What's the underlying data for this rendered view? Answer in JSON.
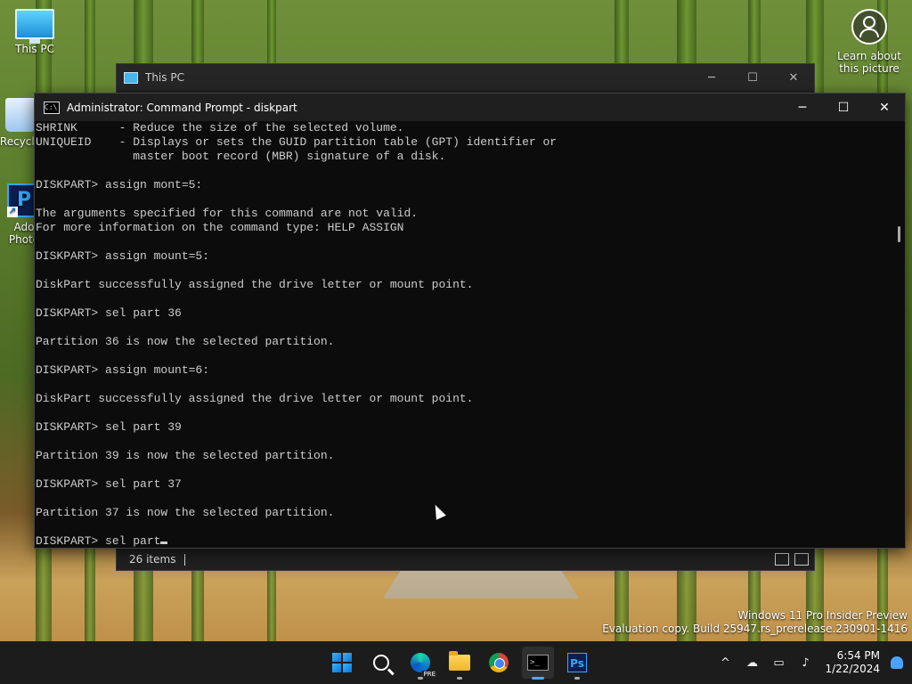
{
  "desktop": {
    "icons": [
      {
        "label": "This PC"
      },
      {
        "label": "Recycle"
      },
      {
        "label": "Ado\nPhoto"
      }
    ],
    "learn_label": "Learn about this picture",
    "watermark": {
      "line1": "Windows 11 Pro Insider Preview",
      "line2": "Evaluation copy. Build 25947.rs_prerelease.230901-1416"
    }
  },
  "explorer": {
    "title": "This PC",
    "status_count": "26 items"
  },
  "cmd": {
    "title": "Administrator: Command Prompt - diskpart",
    "lines": [
      "SHRINK      - Reduce the size of the selected volume.",
      "UNIQUEID    - Displays or sets the GUID partition table (GPT) identifier or",
      "              master boot record (MBR) signature of a disk.",
      "",
      "DISKPART> assign mont=5:",
      "",
      "The arguments specified for this command are not valid.",
      "For more information on the command type: HELP ASSIGN",
      "",
      "DISKPART> assign mount=5:",
      "",
      "DiskPart successfully assigned the drive letter or mount point.",
      "",
      "DISKPART> sel part 36",
      "",
      "Partition 36 is now the selected partition.",
      "",
      "DISKPART> assign mount=6:",
      "",
      "DiskPart successfully assigned the drive letter or mount point.",
      "",
      "DISKPART> sel part 39",
      "",
      "Partition 39 is now the selected partition.",
      "",
      "DISKPART> sel part 37",
      "",
      "Partition 37 is now the selected partition.",
      ""
    ],
    "prompt_line": "DISKPART> sel part"
  },
  "taskbar": {
    "edge_badge": "PRE",
    "time": "6:54 PM",
    "date": "1/22/2024"
  },
  "window_controls": {
    "minimize": "─",
    "maximize": "☐",
    "close": "✕"
  },
  "icons": {
    "caret_up": "^",
    "cmd_glyph": "C:\\",
    "terminal_glyph": ">_",
    "ps_glyph": "Ps",
    "ps_desktop_glyph": "P",
    "shortcut_glyph": "↗"
  }
}
